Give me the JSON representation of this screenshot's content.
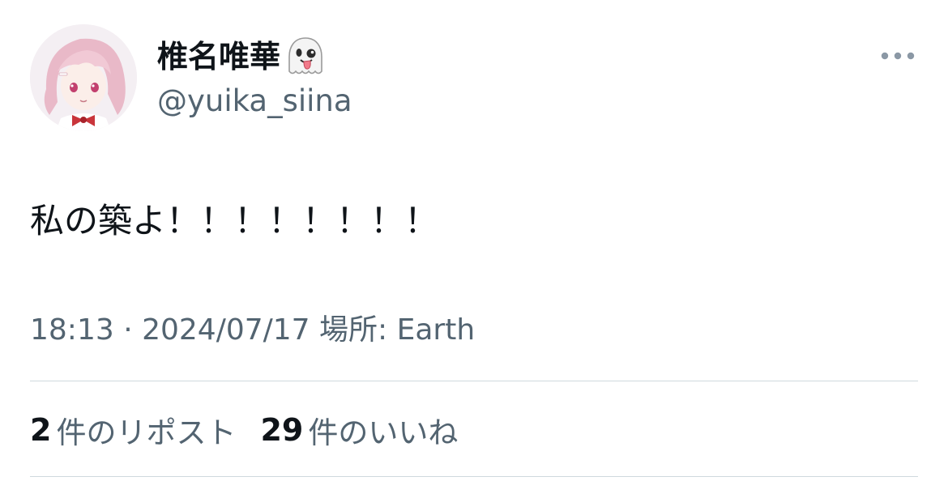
{
  "user": {
    "display_name": "椎名唯華",
    "name_icon": "ghost-tongue-emoji",
    "handle": "@yuika_siina",
    "avatar": "anime-character-pink-hair-avatar"
  },
  "header": {
    "more_icon": "more-horizontal-icon"
  },
  "tweet": {
    "text": "私の築よ！！！！！！！！"
  },
  "meta": {
    "time": "18:13",
    "separator": " · ",
    "date": "2024/07/17",
    "location": " 場所: Earth"
  },
  "stats": {
    "reposts_count": "2",
    "reposts_label": "件のリポスト",
    "likes_count": "29",
    "likes_label": "件のいいね"
  },
  "colors": {
    "text_primary": "#0f1419",
    "text_secondary": "#536471",
    "divider": "#cfd9de"
  }
}
